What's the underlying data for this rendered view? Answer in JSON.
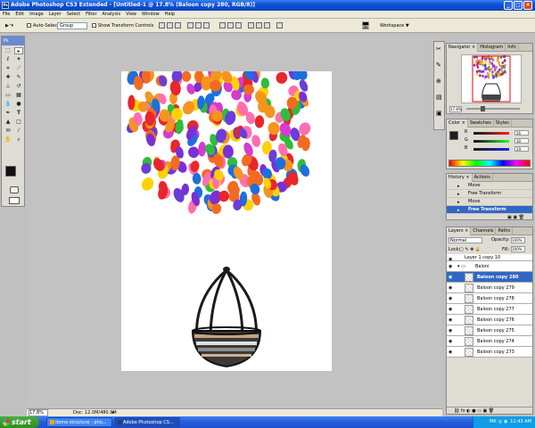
{
  "window": {
    "title": "Adobe Photoshop CS3 Extended - [Untitled-1 @ 17.8% (Baloon copy 280, RGB/8)]",
    "app_icon": "Ps"
  },
  "menu": [
    "File",
    "Edit",
    "Image",
    "Layer",
    "Select",
    "Filter",
    "Analysis",
    "View",
    "Window",
    "Help"
  ],
  "options_bar": {
    "auto_select_label": "Auto-Select:",
    "auto_select_value": "Group",
    "show_transform_label": "Show Transform Controls",
    "workspace_label": "Workspace ▼"
  },
  "toolbox": {
    "logo": "Ps"
  },
  "status": {
    "zoom": "17.8%",
    "doc": "Doc: 12.0M/480.9M"
  },
  "navigator": {
    "tabs": [
      "Navigator ×",
      "Histogram",
      "Info"
    ],
    "zoom": "17.8%"
  },
  "color_panel": {
    "tabs": [
      "Color ×",
      "Swatches",
      "Styles"
    ],
    "r_label": "R",
    "g_label": "G",
    "b_label": "B",
    "r": "26",
    "g": "30",
    "b": "29"
  },
  "history": {
    "tabs": [
      "History ×",
      "Actions"
    ],
    "items": [
      "Move",
      "Free Transform",
      "Move",
      "Free Transform"
    ],
    "selected_index": 3
  },
  "layers": {
    "tabs": [
      "Layers ×",
      "Channels",
      "Paths"
    ],
    "blend": "Normal",
    "opacity_label": "Opacity:",
    "opacity": "100%",
    "lock_label": "Lock:",
    "fill_label": "Fill:",
    "fill": "100%",
    "items": [
      "Layer 1 copy 10",
      "Baloni",
      "Baloon copy 280",
      "Baloon copy 279",
      "Baloon copy 278",
      "Baloon copy 277",
      "Baloon copy 276",
      "Baloon copy 275",
      "Baloon copy 274",
      "Baloon copy 273"
    ],
    "group_index": 1,
    "selected_index": 2
  },
  "taskbar": {
    "start": "start",
    "tasks": [
      "dome structure - pho...",
      "Adobe Photoshop CS..."
    ],
    "time": "11:43 AM",
    "lang": "MK"
  }
}
